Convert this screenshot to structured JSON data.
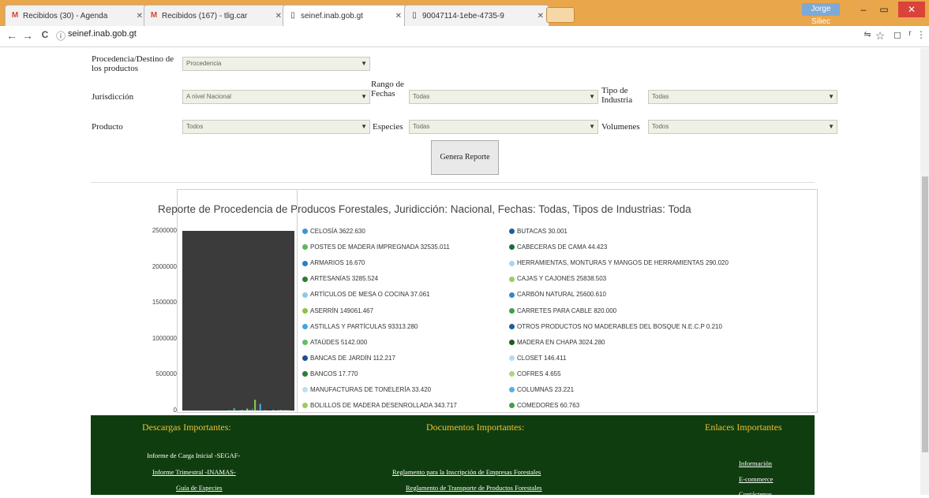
{
  "browser": {
    "tabs": [
      {
        "label": "Recibidos (30) - Agenda",
        "icon": "gmail-icon"
      },
      {
        "label": "Recibidos (167) - tlig.car",
        "icon": "gmail-icon"
      },
      {
        "label": "seinef.inab.gob.gt",
        "icon": "page-icon"
      },
      {
        "label": "90047114-1ebe-4735-9",
        "icon": "page-icon"
      }
    ],
    "profile": "Jorge Siliec",
    "url": "seinef.inab.gob.gt",
    "nav": {
      "back": "←",
      "forward": "→",
      "reload": "C",
      "info": "ⓘ"
    },
    "toolbar": {
      "translate": "⇋",
      "star": "☆",
      "cast": "◻",
      "ext": "r",
      "menu": "⋮"
    },
    "window": {
      "minimize": "–",
      "restore": "▭",
      "close": "✕"
    }
  },
  "form": {
    "procedencia_label": "Procedencia/Destino de los productos",
    "procedencia_value": "Procedencia",
    "jurisdiccion_label": "Jurisdicción",
    "jurisdiccion_value": "A nivel Nacional",
    "rango_label": "Rango de Fechas",
    "rango_value": "Todas",
    "tipo_label": "Tipo de Industria",
    "tipo_value": "Todas",
    "producto_label": "Producto",
    "producto_value": "Todos",
    "especies_label": "Especies",
    "especies_value": "Todas",
    "volumenes_label": "Volumenes",
    "volumenes_value": "Todos",
    "button_label": "Genera Reporte"
  },
  "chart_data": {
    "type": "bar",
    "title": "Reporte de Procedencia de Producos Forestales, Juridicción: Nacional, Fechas: Todas, Tipos de Industrias: Toda",
    "ylim": [
      0,
      2500000
    ],
    "yticks": [
      "2500000",
      "2000000",
      "1500000",
      "1000000",
      "500000",
      "0"
    ],
    "ytick_values": [
      2500000,
      2000000,
      1500000,
      1000000,
      500000,
      0
    ],
    "series": [
      {
        "label": "CELOSÍA 3622.630",
        "value": 3622.63,
        "color": "#3e95cd"
      },
      {
        "label": "BUTACAS 30.001",
        "value": 30.001,
        "color": "#1f5f99"
      },
      {
        "label": "POSTES DE MADERA IMPREGNADA 32535.011",
        "value": 32535.011,
        "color": "#5cb85c"
      },
      {
        "label": "CABECERAS DE CAMA 44.423",
        "value": 44.423,
        "color": "#1a6b3a"
      },
      {
        "label": "ARMARIOS 16.670",
        "value": 16.67,
        "color": "#2f7fc0"
      },
      {
        "label": "HERRAMIENTAS, MONTURAS Y MANGOS DE HERRAMIENTAS 290.020",
        "value": 290.02,
        "color": "#a9d6ef"
      },
      {
        "label": "ARTESANÍAS 3285.524",
        "value": 3285.524,
        "color": "#2e7d32"
      },
      {
        "label": "CAJAS Y CAJONES 25838.503",
        "value": 25838.503,
        "color": "#9ccc65"
      },
      {
        "label": "ARTÍCULOS DE MESA O COCINA 37.061",
        "value": 37.061,
        "color": "#8ecae6"
      },
      {
        "label": "CARBÓN NATURAL 25600.610",
        "value": 25600.61,
        "color": "#3a86c8"
      },
      {
        "label": "ASERRÍN 149061.467",
        "value": 149061.467,
        "color": "#8bc34a"
      },
      {
        "label": "CARRETES PARA CABLE 820.000",
        "value": 820.0,
        "color": "#43a047"
      },
      {
        "label": "ASTILLAS Y PARTÍCULAS 93313.280",
        "value": 93313.28,
        "color": "#4aa3df"
      },
      {
        "label": "OTROS PRODUCTOS NO MADERABLES DEL BOSQUE N.E.C.P 0.210",
        "value": 0.21,
        "color": "#1e5c9e"
      },
      {
        "label": "ATAÚDES 5142.000",
        "value": 5142.0,
        "color": "#66bb6a"
      },
      {
        "label": "MADERA EN CHAPA 3024.280",
        "value": 3024.28,
        "color": "#1b5e20"
      },
      {
        "label": "BANCAS DE JARDÍN 112.217",
        "value": 112.217,
        "color": "#1f4e8c"
      },
      {
        "label": "CLOSET 146.411",
        "value": 146.411,
        "color": "#b3dcf2"
      },
      {
        "label": "BANCOS 17.770",
        "value": 17.77,
        "color": "#2e7d32"
      },
      {
        "label": "COFRES 4.655",
        "value": 4.655,
        "color": "#aed581"
      },
      {
        "label": "MANUFACTURAS DE TONELERÍA 33.420",
        "value": 33.42,
        "color": "#bfdff2"
      },
      {
        "label": "COLUMNAS 23.221",
        "value": 23.221,
        "color": "#5aaee0"
      },
      {
        "label": "BOLILLOS DE MADERA DESENROLLADA 343.717",
        "value": 343.717,
        "color": "#9ccc65"
      },
      {
        "label": "COMEDORES 60.763",
        "value": 60.763,
        "color": "#43a047"
      }
    ]
  },
  "footer": {
    "descargas_title": "Descargas Importantes:",
    "descargas_links": [
      "Informe de Carga Inicial -SEGAF-",
      "Informe Trimestral -INAMAS-",
      "Guía de Especies"
    ],
    "documentos_title": "Documentos Importantes:",
    "documentos_links": [
      "Reglamento para la Inscripción de Empresas Forestales",
      "Reglamento de Transporte de Productos Forestales"
    ],
    "enlaces_title": "Enlaces Importantes",
    "enlaces_links": [
      "Información",
      "E-commerce",
      "Contáctenos"
    ]
  }
}
